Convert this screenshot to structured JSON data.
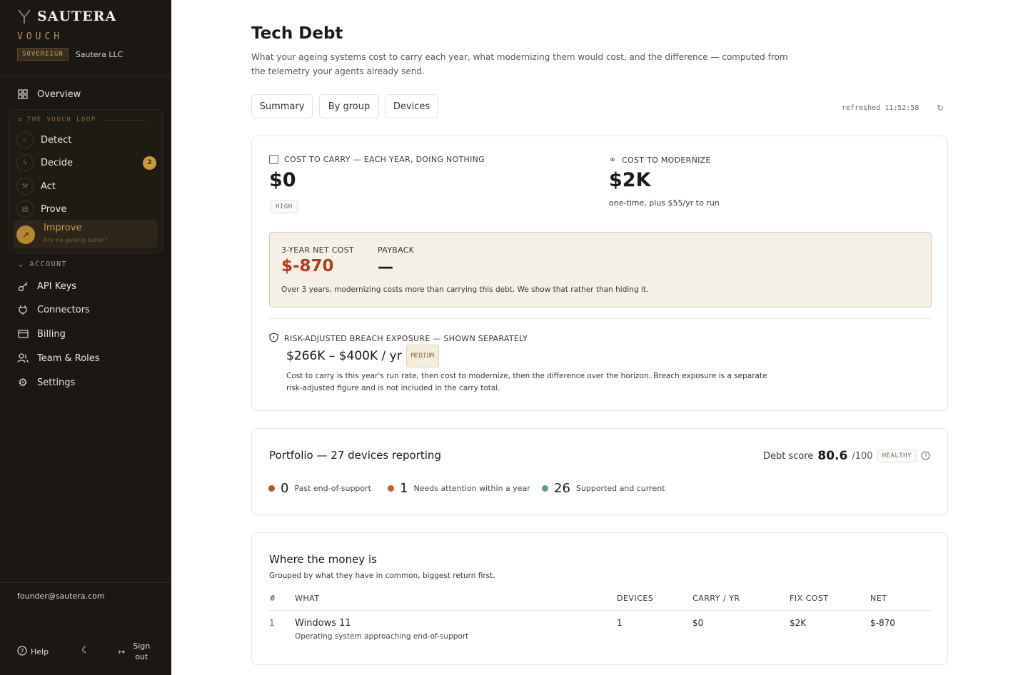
{
  "brand": {
    "name": "SAUTERA",
    "sub": "VOUCH",
    "tag": "SOVEREIGN",
    "org": "Sautera LLC"
  },
  "nav": {
    "overview": "Overview",
    "loop_title": "THE VOUCH LOOP",
    "loop": [
      {
        "label": "Detect"
      },
      {
        "label": "Decide",
        "badge": "2"
      },
      {
        "label": "Act"
      },
      {
        "label": "Prove"
      }
    ],
    "improve": {
      "label": "Improve",
      "sub": "Are we getting better?"
    },
    "account_title": "ACCOUNT",
    "account": [
      {
        "label": "API Keys",
        "icon": "key-icon"
      },
      {
        "label": "Connectors",
        "icon": "plug-icon"
      },
      {
        "label": "Billing",
        "icon": "card-icon"
      },
      {
        "label": "Team & Roles",
        "icon": "users-icon"
      },
      {
        "label": "Settings",
        "icon": "gear-icon"
      }
    ],
    "email": "founder@sautera.com",
    "help": "Help",
    "signout_1": "Sign",
    "signout_2": "out"
  },
  "page": {
    "title": "Tech Debt",
    "description": "What your ageing systems cost to carry each year, what modernizing them would cost, and the difference — computed from the telemetry your agents already send.",
    "tabs": [
      "Summary",
      "By group",
      "Devices"
    ],
    "refreshed": "refreshed 11:52:58"
  },
  "summary": {
    "carry_label": "COST TO CARRY — EACH YEAR, DOING NOTHING",
    "carry_value": "$0",
    "carry_badge": "HIGH",
    "modernize_label": "COST TO MODERNIZE",
    "modernize_value": "$2K",
    "modernize_note": "one-time, plus $55/yr to run",
    "net_label": "3-YEAR NET COST",
    "net_value": "$-870",
    "payback_label": "PAYBACK",
    "payback_value": "—",
    "net_note": "Over 3 years, modernizing costs more than carrying this debt. We show that rather than hiding it.",
    "breach_label": "RISK-ADJUSTED BREACH EXPOSURE — SHOWN SEPARATELY",
    "breach_value": "$266K – $400K / yr",
    "breach_badge": "MEDIUM",
    "footnote": "Cost to carry is this year's run rate, then cost to modernize, then the difference over the horizon. Breach exposure is a separate risk-adjusted figure and is not included in the carry total."
  },
  "portfolio": {
    "title": "Portfolio — 27 devices reporting",
    "score_label": "Debt score",
    "score": "80.6",
    "score_max": "/100",
    "score_badge": "HEALTHY",
    "stats": [
      {
        "n": "0",
        "text": "Past end-of-support",
        "color": "#c2502a"
      },
      {
        "n": "1",
        "text": "Needs attention within a year",
        "color": "#d2582c"
      },
      {
        "n": "26",
        "text": "Supported and current",
        "color": "#5a9e8f"
      }
    ]
  },
  "money": {
    "title": "Where the money is",
    "subtitle": "Grouped by what they have in common, biggest return first.",
    "columns": [
      "#",
      "WHAT",
      "DEVICES",
      "CARRY / YR",
      "FIX COST",
      "NET"
    ],
    "rows": [
      {
        "idx": "1",
        "what": "Windows 11",
        "detail": "Operating system approaching end-of-support",
        "devices": "1",
        "carry": "$0",
        "fix": "$2K",
        "net": "$-870"
      }
    ]
  }
}
